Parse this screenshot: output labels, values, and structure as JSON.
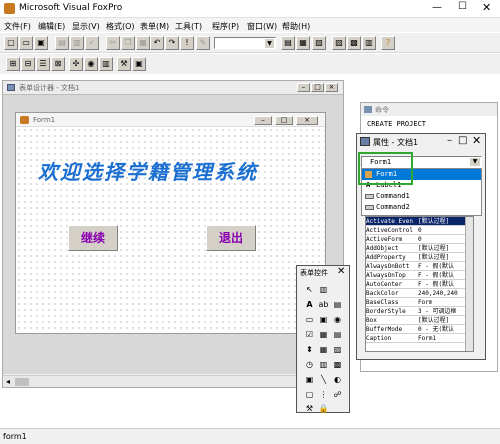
{
  "app": {
    "title": "Microsoft Visual FoxPro",
    "status_text": "form1"
  },
  "menu": [
    "文件(F)",
    "编辑(E)",
    "显示(V)",
    "格式(O)",
    "表单(M)",
    "工具(T)",
    "程序(P)",
    "窗口(W)",
    "帮助(H)"
  ],
  "form_designer": {
    "title": "表单设计器 - 文档1",
    "form_title": "Form1",
    "heading": "欢迎选择学籍管理系统",
    "buttons": [
      "继续",
      "退出"
    ]
  },
  "command_window": {
    "title": "命令",
    "text": "CREATE PROJECT"
  },
  "properties": {
    "title": "属性 - 文档1",
    "selected_object": "Form1",
    "objects": [
      "Form1",
      "Label1",
      "Command1",
      "Command2"
    ],
    "rows": [
      {
        "name": "Activate Even",
        "value": "[默认过程]"
      },
      {
        "name": "ActiveControl",
        "value": "0"
      },
      {
        "name": "ActiveForm",
        "value": "0"
      },
      {
        "name": "AddObject",
        "value": "[默认过程]"
      },
      {
        "name": "AddProperty",
        "value": "[默认过程]"
      },
      {
        "name": "AlwaysOnBott",
        "value": "F - 假(默认"
      },
      {
        "name": "AlwaysOnTop",
        "value": "F - 假(默认"
      },
      {
        "name": "AutoCenter",
        "value": "F - 假(默认"
      },
      {
        "name": "BackColor",
        "value": "240,240,240"
      },
      {
        "name": "BaseClass",
        "value": "Form"
      },
      {
        "name": "BorderStyle",
        "value": "3 - 可调边框"
      },
      {
        "name": "Box",
        "value": "[默认过程]"
      },
      {
        "name": "BufferMode",
        "value": "0 - 无(默认"
      },
      {
        "name": "Caption",
        "value": "Form1"
      }
    ]
  },
  "toolbox": {
    "title": "表单控件"
  },
  "colors": {
    "title_active": "#0a246a",
    "title_inactive": "#808080",
    "heading": "#1a6fd0",
    "accent_green": "#2ea82e",
    "button_text": "#8a00b0"
  }
}
